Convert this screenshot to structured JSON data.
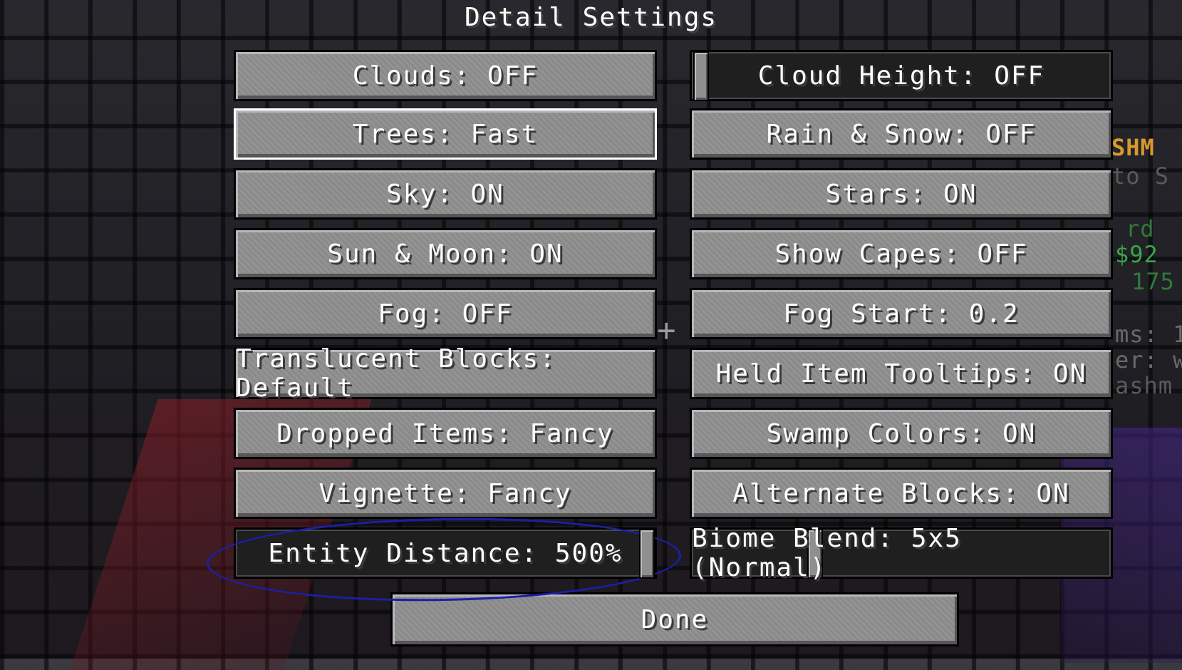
{
  "title": "Detail Settings",
  "left_column": [
    {
      "label": "Clouds: OFF"
    },
    {
      "label": "Trees: Fast"
    },
    {
      "label": "Sky: ON"
    },
    {
      "label": "Sun & Moon: ON"
    },
    {
      "label": "Fog: OFF"
    },
    {
      "label": "Translucent Blocks: Default"
    },
    {
      "label": "Dropped Items: Fancy"
    },
    {
      "label": "Vignette: Fancy"
    },
    {
      "label": "Entity Distance: 500%"
    }
  ],
  "right_column": [
    {
      "label": "Cloud Height: OFF"
    },
    {
      "label": "Rain & Snow: OFF"
    },
    {
      "label": "Stars: ON"
    },
    {
      "label": "Show Capes: OFF"
    },
    {
      "label": "Fog Start: 0.2"
    },
    {
      "label": "Held Item Tooltips: ON"
    },
    {
      "label": "Swamp Colors: ON"
    },
    {
      "label": "Alternate Blocks: ON"
    },
    {
      "label": "Biome Blend: 5x5 (Normal)"
    }
  ],
  "done_label": "Done",
  "background_text": {
    "line1": "SHM",
    "line2": "to S",
    "line3": "rd",
    "line4": "$92",
    "line5": "175",
    "line6": "ms: 1",
    "line7": "er: w",
    "line8": "ashm"
  },
  "colors": {
    "button_face": "#8f8f8f",
    "slider_track": "#1f1f1f",
    "hover_border": "#ffffff",
    "annotation": "#1b1fa8",
    "sidebar_gold": "#d89a2a",
    "sidebar_green": "#3aa64a"
  },
  "sliders": {
    "cloud_height_fraction": 0.0,
    "entity_distance_fraction": 1.0,
    "biome_blend_fraction": 0.27
  }
}
